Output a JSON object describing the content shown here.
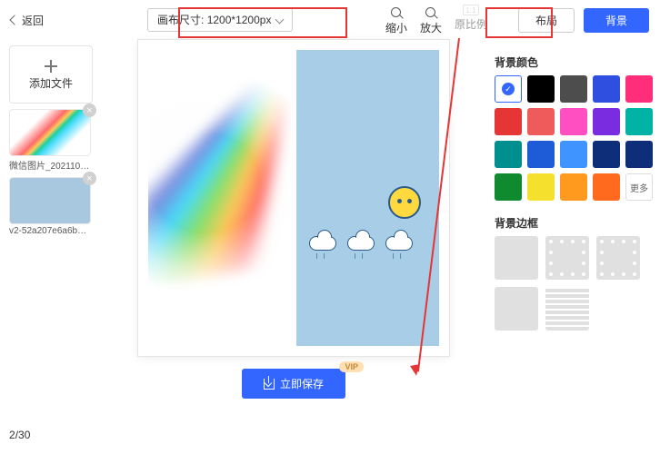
{
  "topbar": {
    "back_label": "返回",
    "canvas_size_prefix": "画布尺寸:",
    "canvas_size_value": "1200*1200px",
    "zoom_out_label": "缩小",
    "zoom_in_label": "放大",
    "ratio_icon_text": "1:1",
    "ratio_label": "原比例",
    "tab_layout": "布局",
    "tab_background": "背景"
  },
  "sidebar": {
    "add_file_label": "添加文件",
    "thumbs": [
      {
        "filename": "微信图片_20211009..."
      },
      {
        "filename": "v2-52a207e6a6b6ad6..."
      }
    ],
    "page_current": "2",
    "page_total": "/30"
  },
  "save": {
    "button_label": "立即保存",
    "vip_badge": "VIP"
  },
  "right_panel": {
    "section_bg_color": "背景颜色",
    "section_bg_border": "背景边框",
    "more_label": "更多",
    "colors": [
      "#ffffff",
      "#000000",
      "#4d4d4d",
      "#2e4fe0",
      "#ff2d7a",
      "#e53535",
      "#ef5b5b",
      "#ff4fc0",
      "#7a2de0",
      "#00b3a4",
      "#008f8f",
      "#1e5bd6",
      "#3f94ff",
      "#0f2e7a",
      "#0f2e7a",
      "#0f8a2e",
      "#f5e02e",
      "#ff9a1f",
      "#ff6a1f"
    ]
  }
}
